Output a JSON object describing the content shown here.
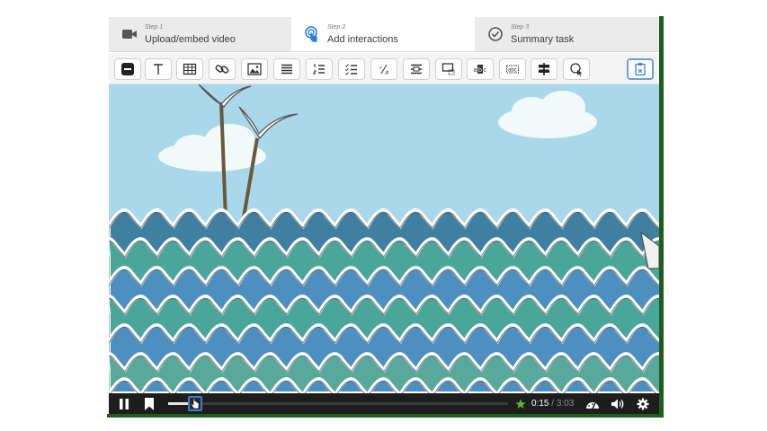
{
  "steps": [
    {
      "small": "Step 1",
      "label": "Upload/embed video",
      "icon": "video-camera-icon"
    },
    {
      "small": "Step 2",
      "label": "Add interactions",
      "icon": "touch-icon",
      "active": true
    },
    {
      "small": "Step 3",
      "label": "Summary task",
      "icon": "check-circle-icon"
    }
  ],
  "toolbar": {
    "buttons": [
      {
        "name": "label-tool-icon"
      },
      {
        "name": "text-tool-icon"
      },
      {
        "name": "table-tool-icon"
      },
      {
        "name": "link-tool-icon"
      },
      {
        "name": "image-tool-icon"
      },
      {
        "name": "statements-tool-icon"
      },
      {
        "name": "single-choice-tool-icon"
      },
      {
        "name": "multiple-choice-tool-icon"
      },
      {
        "name": "true-false-tool-icon"
      },
      {
        "name": "fill-blanks-tool-icon"
      },
      {
        "name": "drag-drop-tool-icon"
      },
      {
        "name": "mark-words-tool-icon"
      },
      {
        "name": "drag-text-tool-icon"
      },
      {
        "name": "crossroads-tool-icon"
      },
      {
        "name": "navigation-hotspot-tool-icon"
      },
      {
        "name": "paste-tool-icon",
        "selected": true
      }
    ]
  },
  "player": {
    "current_time": "0:15",
    "separator": " / ",
    "total_time": "3:03",
    "progress": 0.082
  },
  "colors": {
    "sky": "#a9d8ea",
    "sea_dark": "#3f8aa3",
    "sea_teal": "#4fae9e",
    "sea_blue": "#4d8fbf",
    "controls": "#1d1d1d",
    "accent": "#3f7fd0"
  }
}
